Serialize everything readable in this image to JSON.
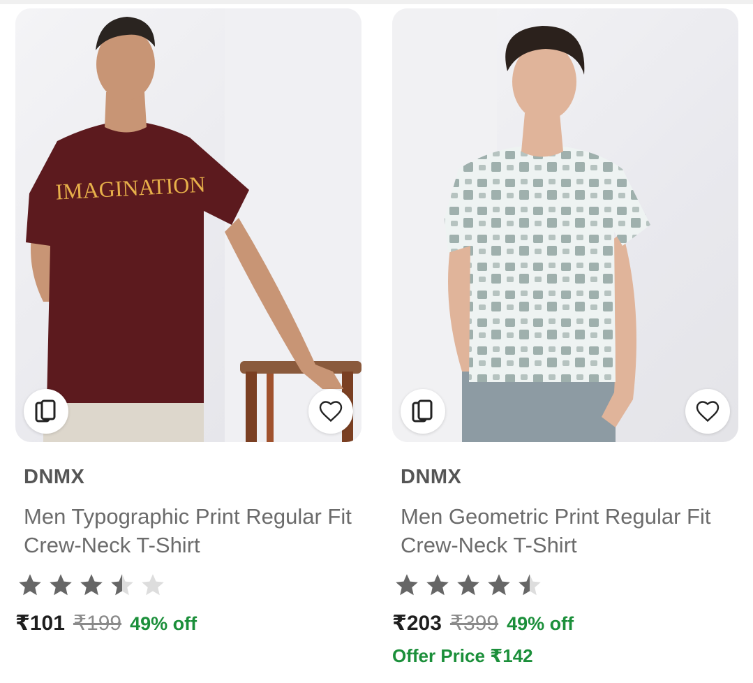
{
  "products": [
    {
      "brand": "DNMX",
      "title": "Men Typographic Print Regular Fit Crew-Neck T-Shirt",
      "shirt_print": "IMAGINATION",
      "rating": 3.5,
      "price": "₹101",
      "mrp": "₹199",
      "discount": "49% off",
      "icons": {
        "compare": "card-stack-icon",
        "wishlist": "heart-icon"
      }
    },
    {
      "brand": "DNMX",
      "title": "Men Geometric Print Regular Fit Crew-Neck T-Shirt",
      "rating": 4.5,
      "price": "₹203",
      "mrp": "₹399",
      "discount": "49% off",
      "offer_price": "Offer Price ₹142",
      "icons": {
        "compare": "card-stack-icon",
        "wishlist": "heart-icon"
      }
    }
  ],
  "colors": {
    "star_filled": "#666666",
    "star_empty": "#dddddd",
    "discount_green": "#1b8f3a"
  }
}
